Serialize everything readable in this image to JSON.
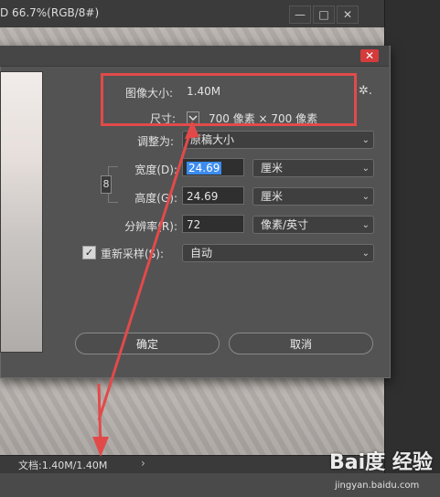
{
  "document": {
    "title": "D 66.7%(RGB/8#)",
    "window_buttons": [
      "—",
      "□",
      "✕"
    ]
  },
  "dialog": {
    "image_size_label": "图像大小:",
    "image_size_value": "1.40M",
    "dimensions_label": "尺寸:",
    "dimensions_value": "700 像素 × 700 像素",
    "fit_to_label": "调整为:",
    "fit_to_value": "原稿大小",
    "width_label": "宽度(D):",
    "width_value": "24.69",
    "width_unit": "厘米",
    "height_label": "高度(G):",
    "height_value": "24.69",
    "height_unit": "厘米",
    "resolution_label": "分辨率(R):",
    "resolution_value": "72",
    "resolution_unit": "像素/英寸",
    "resample_label": "重新采样(S):",
    "resample_value": "自动",
    "ok_label": "确定",
    "cancel_label": "取消",
    "close_glyph": "✕",
    "link_glyph": "8",
    "check_glyph": "✓",
    "gear_glyph": "✲."
  },
  "status": {
    "doc_info": "文档:1.40M/1.40M",
    "arrow": "›"
  },
  "watermark": {
    "brand": "Bai度 经验",
    "url": "jingyan.baidu.com"
  },
  "colors": {
    "accent": "#3c8cf0",
    "annotation": "#e24a4a",
    "dialog_bg": "#535353"
  }
}
